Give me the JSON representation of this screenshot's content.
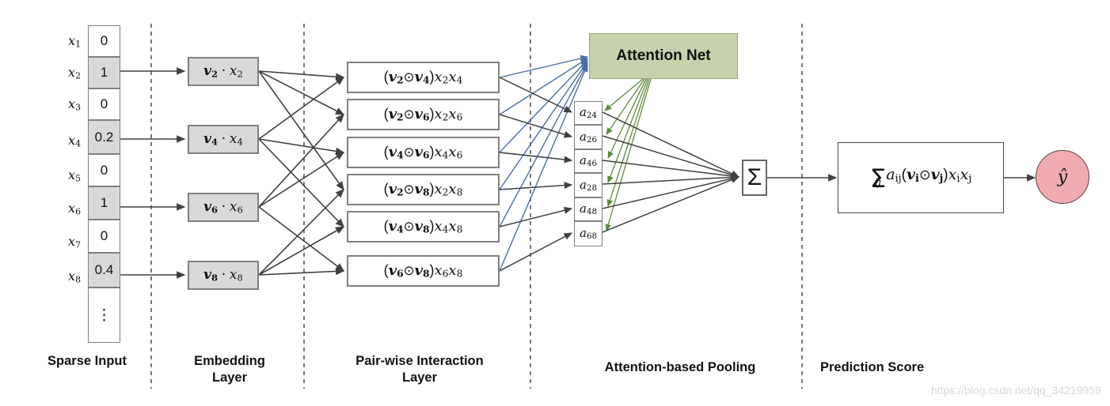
{
  "diagram": {
    "title": "Attentional Factorization Machine (AFM) architecture",
    "watermark": "https://blog.csdn.net/qq_34219959"
  },
  "colors": {
    "attention_net_fill": "#c5d2ad",
    "yhat_fill": "#f0acb0",
    "embedding_fill": "#d9d9d9",
    "active_cell_fill": "#d9d9d9",
    "blue_arrow": "#4a6fa5",
    "green_arrow": "#5f8a3f",
    "black_arrow": "#404040",
    "divider": "#555555"
  },
  "sparse_input": {
    "rows": [
      {
        "label_base": "x",
        "label_sub": "1",
        "value": "0",
        "active": false
      },
      {
        "label_base": "x",
        "label_sub": "2",
        "value": "1",
        "active": true
      },
      {
        "label_base": "x",
        "label_sub": "3",
        "value": "0",
        "active": false
      },
      {
        "label_base": "x",
        "label_sub": "4",
        "value": "0.2",
        "active": true
      },
      {
        "label_base": "x",
        "label_sub": "5",
        "value": "0",
        "active": false
      },
      {
        "label_base": "x",
        "label_sub": "6",
        "value": "1",
        "active": true
      },
      {
        "label_base": "x",
        "label_sub": "7",
        "value": "0",
        "active": false
      },
      {
        "label_base": "x",
        "label_sub": "8",
        "value": "0.4",
        "active": true
      }
    ],
    "continuation": "⋮"
  },
  "embedding_layer": {
    "nodes": [
      {
        "v": "v",
        "v_sub": "2",
        "op": "·",
        "x": "x",
        "x_sub": "2"
      },
      {
        "v": "v",
        "v_sub": "4",
        "op": "·",
        "x": "x",
        "x_sub": "4"
      },
      {
        "v": "v",
        "v_sub": "6",
        "op": "·",
        "x": "x",
        "x_sub": "6"
      },
      {
        "v": "v",
        "v_sub": "8",
        "op": "·",
        "x": "x",
        "x_sub": "8"
      }
    ]
  },
  "interaction_layer": {
    "op": "⊙",
    "nodes": [
      {
        "i": "2",
        "j": "4"
      },
      {
        "i": "2",
        "j": "6"
      },
      {
        "i": "4",
        "j": "6"
      },
      {
        "i": "2",
        "j": "8"
      },
      {
        "i": "4",
        "j": "8"
      },
      {
        "i": "6",
        "j": "8"
      }
    ]
  },
  "attention": {
    "net_label": "Attention Net",
    "coefficients": [
      {
        "sym": "a",
        "sub": "24"
      },
      {
        "sym": "a",
        "sub": "26"
      },
      {
        "sym": "a",
        "sub": "46"
      },
      {
        "sym": "a",
        "sub": "28"
      },
      {
        "sym": "a",
        "sub": "48"
      },
      {
        "sym": "a",
        "sub": "68"
      }
    ],
    "sum_symbol": "Σ"
  },
  "prediction": {
    "sum_symbol": "Σ",
    "sum_sub": "ij",
    "coef": "a",
    "coef_sub": "ij",
    "v_left": "v",
    "v_left_sub": "i",
    "odot": "⊙",
    "v_right": "v",
    "v_right_sub": "j",
    "x_left": "x",
    "x_left_sub": "i",
    "x_right": "x",
    "x_right_sub": "j",
    "output": "ŷ"
  },
  "section_labels": [
    {
      "line1": "Sparse Input",
      "line2": ""
    },
    {
      "line1": "Embedding",
      "line2": "Layer"
    },
    {
      "line1": "Pair-wise Interaction",
      "line2": "Layer"
    },
    {
      "line1": "Attention-based Pooling",
      "line2": ""
    },
    {
      "line1": "Prediction Score",
      "line2": ""
    }
  ]
}
